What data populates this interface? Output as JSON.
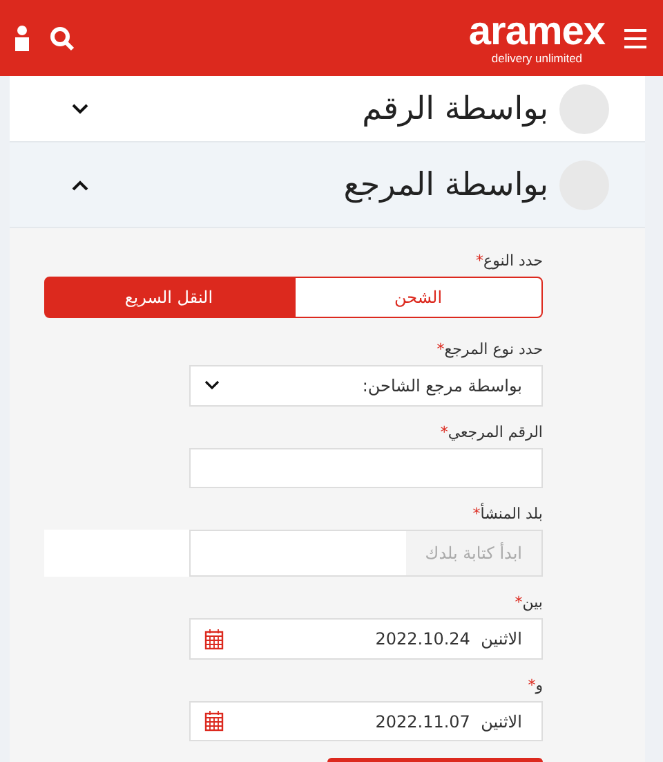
{
  "header": {
    "logo": "aramex",
    "tagline": "delivery unlimited"
  },
  "sections": [
    {
      "title": "بواسطة الرقم",
      "expanded": false
    },
    {
      "title": "بواسطة المرجع",
      "expanded": true
    }
  ],
  "form": {
    "type_label": "حدد النوع",
    "required_mark": "*",
    "tabs": [
      {
        "label": "الشحن",
        "selected": false
      },
      {
        "label": "النقل السريع",
        "selected": true
      }
    ],
    "fields": [
      {
        "kind": "select",
        "label": "حدد نوع المرجع",
        "value": "بواسطة مرجع الشاحن:"
      },
      {
        "kind": "text",
        "label": "الرقم المرجعي"
      },
      {
        "kind": "autocomplete",
        "label": "بلد المنشأ",
        "placeholder": "ابدأ كتابة بلدك"
      },
      {
        "kind": "date",
        "label": "بين",
        "day": "الاثنين",
        "value": "2022.10.24"
      },
      {
        "kind": "date",
        "label": "و",
        "day": "الاثنين",
        "value": "2022.11.07"
      }
    ],
    "buttons": [
      {
        "kind": "primary"
      }
    ]
  }
}
